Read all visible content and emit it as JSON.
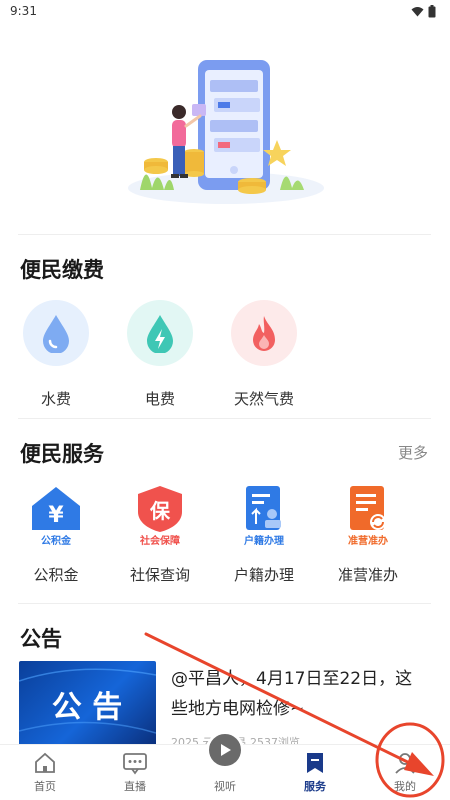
{
  "status_bar": {
    "time": "9:31"
  },
  "payment": {
    "title": "便民缴费",
    "items": [
      {
        "label": "水费",
        "icon": "water-drop-icon",
        "bg": "#e6f0fd",
        "fg": "#7eabf2"
      },
      {
        "label": "电费",
        "icon": "lightning-icon",
        "bg": "#e2f7f4",
        "fg": "#3fc7b5"
      },
      {
        "label": "天然气费",
        "icon": "flame-icon",
        "bg": "#fdeaea",
        "fg": "#f26060"
      }
    ]
  },
  "services": {
    "title": "便民服务",
    "more": "更多",
    "items": [
      {
        "label": "公积金",
        "icon_caption": "公积金",
        "icon": "housing-fund-icon",
        "color": "#2f7ae5"
      },
      {
        "label": "社保查询",
        "icon_caption": "社会保障",
        "icon_glyph": "保",
        "icon": "social-security-icon",
        "color": "#f0524d"
      },
      {
        "label": "户籍办理",
        "icon_caption": "户籍办理",
        "icon": "household-registration-icon",
        "color": "#2f7ae5"
      },
      {
        "label": "准营准办",
        "icon_caption": "准营准办",
        "icon": "business-permit-icon",
        "color": "#f06a2a"
      }
    ]
  },
  "announcement": {
    "title": "公告",
    "thumb_text": "公 告",
    "news_title": "@平昌人，4月17日至22日，这些地方电网检修~",
    "news_meta": "2025  云上平昌  2537浏览"
  },
  "tabbar": {
    "tabs": [
      {
        "label": "首页",
        "icon": "home-icon"
      },
      {
        "label": "直播",
        "icon": "live-icon"
      },
      {
        "label": "视听",
        "icon": "play-icon"
      },
      {
        "label": "服务",
        "icon": "service-icon",
        "active": true
      },
      {
        "label": "我的",
        "icon": "profile-icon"
      }
    ]
  },
  "colors": {
    "accent": "#1a3a8a",
    "annotation": "#e8452c"
  }
}
